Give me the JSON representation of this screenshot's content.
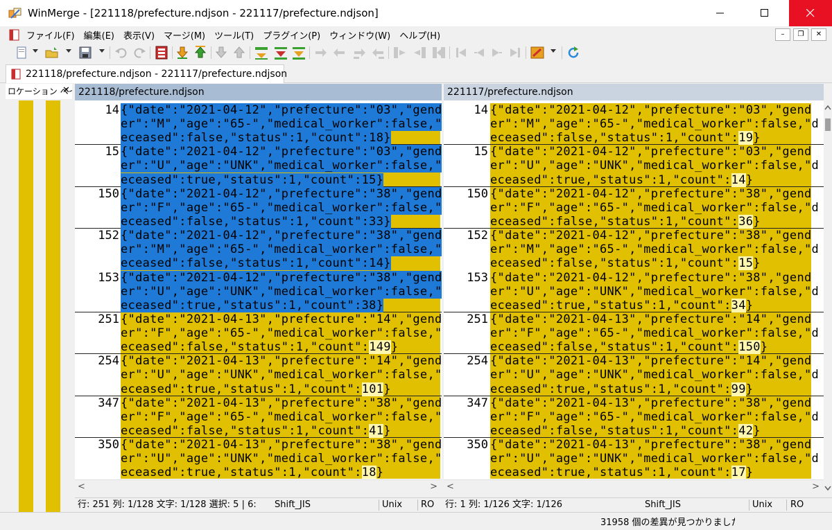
{
  "window": {
    "title": "WinMerge - [221118/prefecture.ndjson - 221117/prefecture.ndjson]"
  },
  "menu": {
    "items": [
      "ファイル(F)",
      "編集(E)",
      "表示(V)",
      "マージ(M)",
      "ツール(T)",
      "プラグイン(P)",
      "ウィンドウ(W)",
      "ヘルプ(H)"
    ]
  },
  "tab": {
    "label": "221118/prefecture.ndjson - 221117/prefecture.ndjson"
  },
  "location_pane": {
    "title": "ロケーション ペイン"
  },
  "left": {
    "header": "221118/prefecture.ndjson",
    "rows": [
      {
        "ln": "14",
        "lines": [
          "{\"date\":\"2021-04-12\",\"prefecture\":\"03\",\"gend",
          "er\":\"M\",\"age\":\"65-\",\"medical_worker\":false,\"d",
          "eceased\":false,\"status\":1,\"count\":18}"
        ],
        "selected": true
      },
      {
        "ln": "15",
        "lines": [
          "{\"date\":\"2021-04-12\",\"prefecture\":\"03\",\"gend",
          "er\":\"U\",\"age\":\"UNK\",\"medical_worker\":false,\"d",
          "eceased\":true,\"status\":1,\"count\":15}"
        ],
        "selected": true
      },
      {
        "ln": "150",
        "lines": [
          "{\"date\":\"2021-04-12\",\"prefecture\":\"38\",\"gend",
          "er\":\"F\",\"age\":\"65-\",\"medical_worker\":false,\"d",
          "eceased\":false,\"status\":1,\"count\":33}"
        ],
        "selected": true
      },
      {
        "ln": "152",
        "lines": [
          "{\"date\":\"2021-04-12\",\"prefecture\":\"38\",\"gend",
          "er\":\"M\",\"age\":\"65-\",\"medical_worker\":false,\"d",
          "eceased\":false,\"status\":1,\"count\":14}"
        ],
        "selected": true,
        "nb": true
      },
      {
        "ln": "153",
        "lines": [
          "{\"date\":\"2021-04-12\",\"prefecture\":\"38\",\"gend",
          "er\":\"U\",\"age\":\"UNK\",\"medical_worker\":false,\"d",
          "eceased\":true,\"status\":1,\"count\":38}"
        ],
        "selected": true
      },
      {
        "ln": "251",
        "lines": [
          "{\"date\":\"2021-04-13\",\"prefecture\":\"14\",\"gend",
          "er\":\"F\",\"age\":\"65-\",\"medical_worker\":false,\"d",
          "eceased\":false,\"status\":1,\"count\":149}"
        ]
      },
      {
        "ln": "254",
        "lines": [
          "{\"date\":\"2021-04-13\",\"prefecture\":\"14\",\"gend",
          "er\":\"U\",\"age\":\"UNK\",\"medical_worker\":false,\"d",
          "eceased\":true,\"status\":1,\"count\":101}"
        ]
      },
      {
        "ln": "347",
        "lines": [
          "{\"date\":\"2021-04-13\",\"prefecture\":\"38\",\"gend",
          "er\":\"F\",\"age\":\"65-\",\"medical_worker\":false,\"d",
          "eceased\":false,\"status\":1,\"count\":41}"
        ]
      },
      {
        "ln": "350",
        "lines": [
          "{\"date\":\"2021-04-13\",\"prefecture\":\"38\",\"gend",
          "er\":\"U\",\"age\":\"UNK\",\"medical_worker\":false,\"d",
          "eceased\":true,\"status\":1,\"count\":18}"
        ],
        "nb": true
      }
    ]
  },
  "right": {
    "header": "221117/prefecture.ndjson",
    "rows": [
      {
        "ln": "14",
        "lines": [
          "{\"date\":\"2021-04-12\",\"prefecture\":\"03\",\"gend",
          "er\":\"M\",\"age\":\"65-\",\"medical_worker\":false,\"d",
          "eceased\":false,\"status\":1,\"count\":19}"
        ]
      },
      {
        "ln": "15",
        "lines": [
          "{\"date\":\"2021-04-12\",\"prefecture\":\"03\",\"gend",
          "er\":\"U\",\"age\":\"UNK\",\"medical_worker\":false,\"d",
          "eceased\":true,\"status\":1,\"count\":14}"
        ]
      },
      {
        "ln": "150",
        "lines": [
          "{\"date\":\"2021-04-12\",\"prefecture\":\"38\",\"gend",
          "er\":\"F\",\"age\":\"65-\",\"medical_worker\":false,\"d",
          "eceased\":false,\"status\":1,\"count\":36}"
        ]
      },
      {
        "ln": "152",
        "lines": [
          "{\"date\":\"2021-04-12\",\"prefecture\":\"38\",\"gend",
          "er\":\"M\",\"age\":\"65-\",\"medical_worker\":false,\"d",
          "eceased\":false,\"status\":1,\"count\":15}"
        ],
        "nb": true
      },
      {
        "ln": "153",
        "lines": [
          "{\"date\":\"2021-04-12\",\"prefecture\":\"38\",\"gend",
          "er\":\"U\",\"age\":\"UNK\",\"medical_worker\":false,\"d",
          "eceased\":true,\"status\":1,\"count\":34}"
        ]
      },
      {
        "ln": "251",
        "lines": [
          "{\"date\":\"2021-04-13\",\"prefecture\":\"14\",\"gend",
          "er\":\"F\",\"age\":\"65-\",\"medical_worker\":false,\"d",
          "eceased\":false,\"status\":1,\"count\":150}"
        ]
      },
      {
        "ln": "254",
        "lines": [
          "{\"date\":\"2021-04-13\",\"prefecture\":\"14\",\"gend",
          "er\":\"U\",\"age\":\"UNK\",\"medical_worker\":false,\"d",
          "eceased\":true,\"status\":1,\"count\":99}"
        ]
      },
      {
        "ln": "347",
        "lines": [
          "{\"date\":\"2021-04-13\",\"prefecture\":\"38\",\"gend",
          "er\":\"F\",\"age\":\"65-\",\"medical_worker\":false,\"d",
          "eceased\":false,\"status\":1,\"count\":42}"
        ]
      },
      {
        "ln": "350",
        "lines": [
          "{\"date\":\"2021-04-13\",\"prefecture\":\"38\",\"gend",
          "er\":\"U\",\"age\":\"UNK\",\"medical_worker\":false,\"d",
          "eceased\":true,\"status\":1,\"count\":17}"
        ],
        "nb": true
      }
    ]
  },
  "status_left": {
    "position": "行: 251  列: 1/128  文字: 1/128  選択: 5 | 6:",
    "encoding": "Shift_JIS",
    "eol": "Unix",
    "mode": "RO"
  },
  "status_right": {
    "position": "行: 1  列: 1/126  文字: 1/126",
    "encoding": "Shift_JIS",
    "eol": "Unix",
    "mode": "RO"
  },
  "status_message": "31958 個の差異が見つかりました",
  "icons": {
    "app": "winmerge-icon",
    "toolbar": [
      "new-icon",
      "open-icon",
      "save-icon",
      "undo-icon",
      "redo-icon",
      "options-icon",
      "next-diff-icon",
      "prev-diff-icon",
      "copy-right-icon",
      "copy-left-icon",
      "merge-icon",
      "refresh-icon"
    ]
  },
  "colors": {
    "diff": "#e0c000",
    "selection": "#1e7ad6",
    "changed_word": "#fff7b0",
    "close_button": "#e81123"
  }
}
